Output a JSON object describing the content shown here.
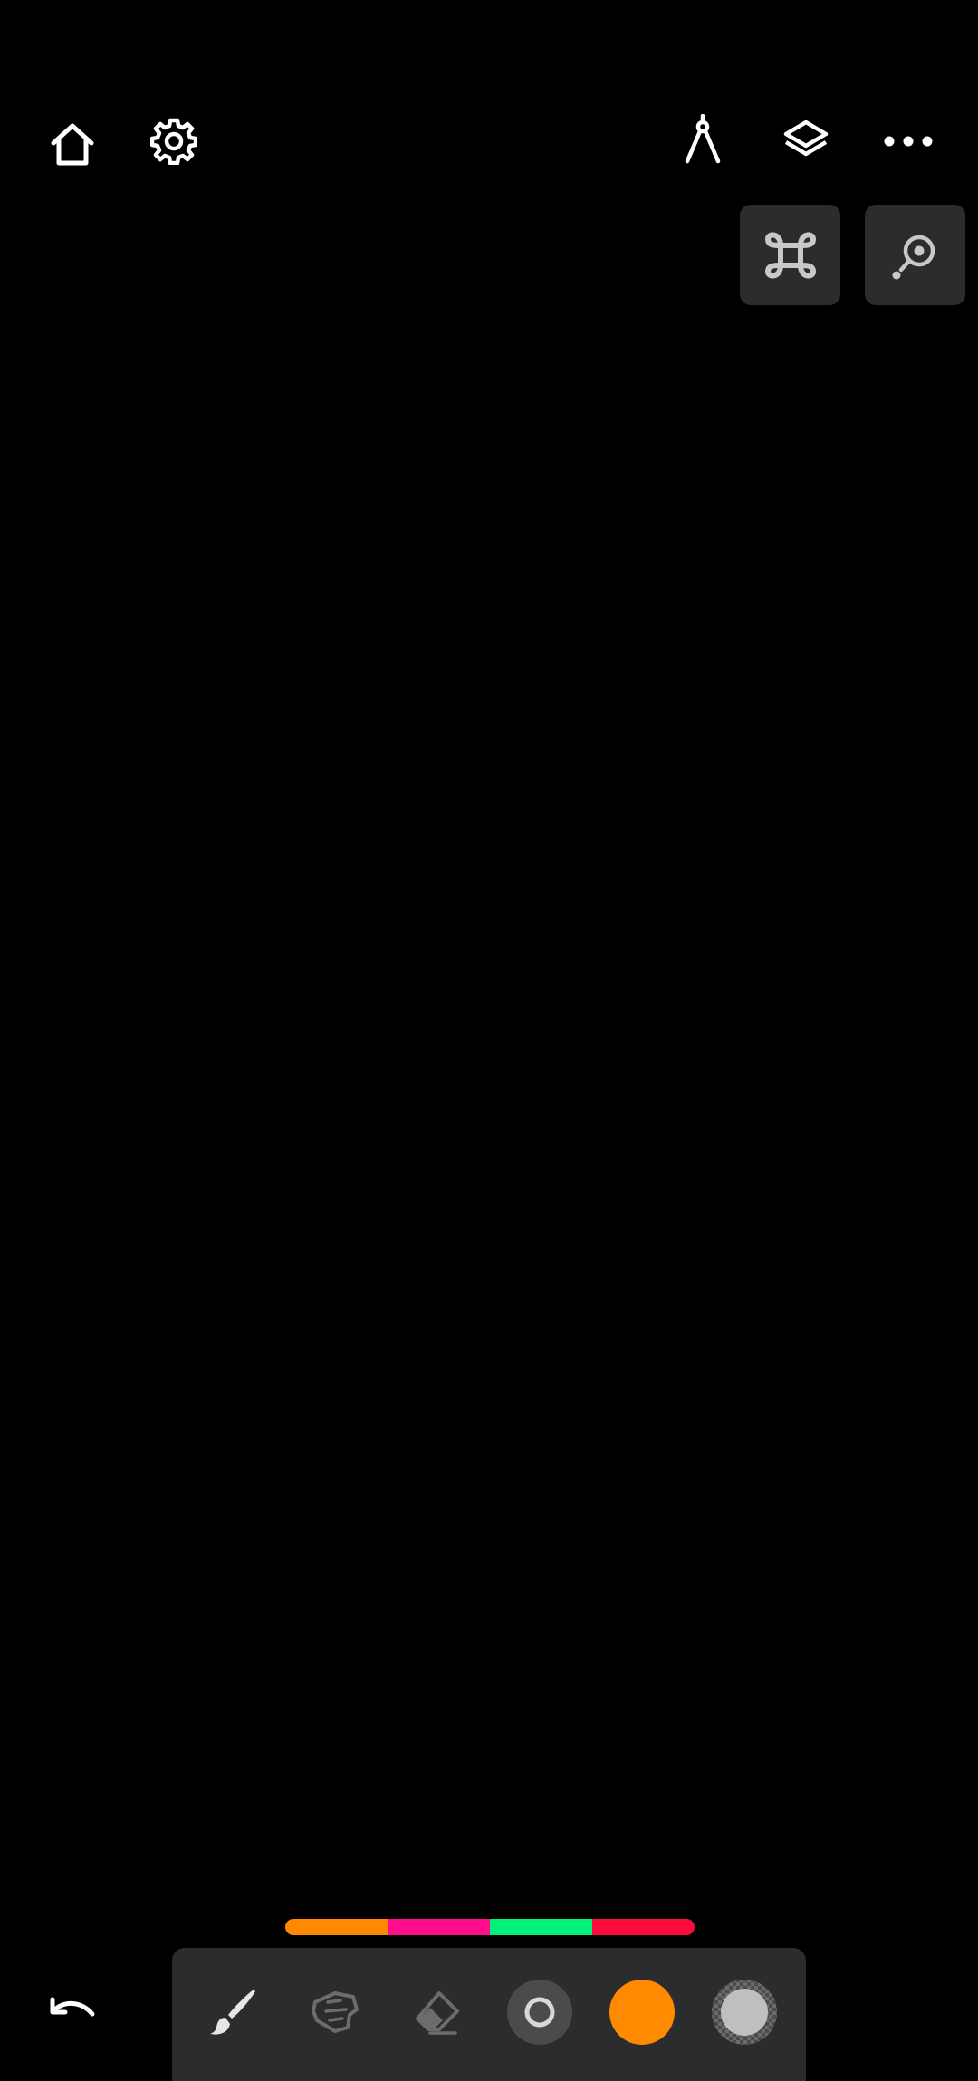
{
  "topbar": {
    "left_icons": [
      "home-icon",
      "settings-gear-icon"
    ],
    "right_icons": [
      "compass-ruler-icon",
      "layers-icon",
      "more-horizontal-icon"
    ]
  },
  "quick_actions": {
    "icons": [
      "command-key-icon",
      "zoom-reference-icon"
    ]
  },
  "canvas": {
    "background": "#000000"
  },
  "palette": {
    "colors": [
      "#FF8A00",
      "#FF0D8A",
      "#00F07A",
      "#FF0A3C"
    ]
  },
  "toolbar": {
    "tools": [
      "brush-icon",
      "smudge-icon",
      "eraser-icon",
      "brush-size-icon",
      "color-picker",
      "opacity-picker"
    ],
    "selected_tool": "brush-icon",
    "current_color": "#FF8A00",
    "opacity_preview": "#BFBFBF"
  },
  "bottom": {
    "undo_icon": "undo-icon"
  }
}
